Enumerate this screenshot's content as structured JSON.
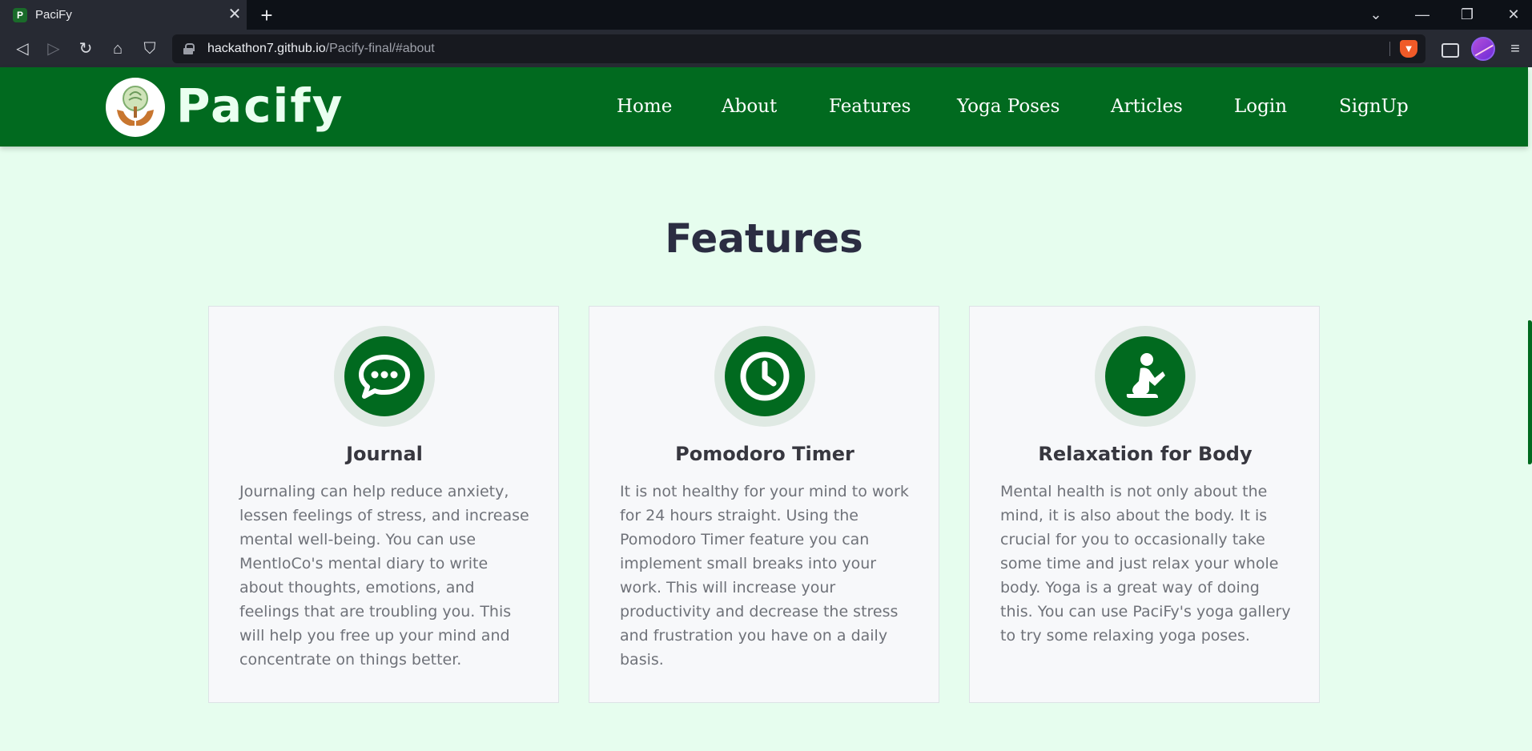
{
  "browser": {
    "tab": {
      "favicon_letter": "P",
      "title": "PaciFy"
    },
    "url": {
      "host": "hackathon7.github.io",
      "path": "/Pacify-final/#about"
    }
  },
  "site": {
    "logo_text": "Pacify",
    "nav": [
      {
        "label": "Home"
      },
      {
        "label": "About"
      },
      {
        "label": "Features"
      },
      {
        "label": "Yoga Poses"
      },
      {
        "label": "Articles"
      },
      {
        "label": "Login"
      },
      {
        "label": "SignUp"
      }
    ]
  },
  "features": {
    "title": "Features",
    "cards": [
      {
        "icon": "chat-bubble-icon",
        "title": "Journal",
        "text": "Journaling can help reduce anxiety, lessen feelings of stress, and increase mental well-being. You can use MentloCo's mental diary to write about thoughts, emotions, and feelings that are troubling you. This will help you free up your mind and concentrate on things better."
      },
      {
        "icon": "clock-icon",
        "title": "Pomodoro Timer",
        "text": "It is not healthy for your mind to work for 24 hours straight. Using the Pomodoro Timer feature you can implement small breaks into your work. This will increase your productivity and decrease the stress and frustration you have on a daily basis."
      },
      {
        "icon": "praying-person-icon",
        "title": "Relaxation for Body",
        "text": "Mental health is not only about the mind, it is also about the body. It is crucial for you to occasionally take some time and just relax your whole body. Yoga is a great way of doing this. You can use PaciFy's yoga gallery to try some relaxing yoga poses."
      }
    ]
  },
  "colors": {
    "header_green": "#016a1f",
    "section_bg": "#e6fdee",
    "title_text": "#2b2d42"
  }
}
